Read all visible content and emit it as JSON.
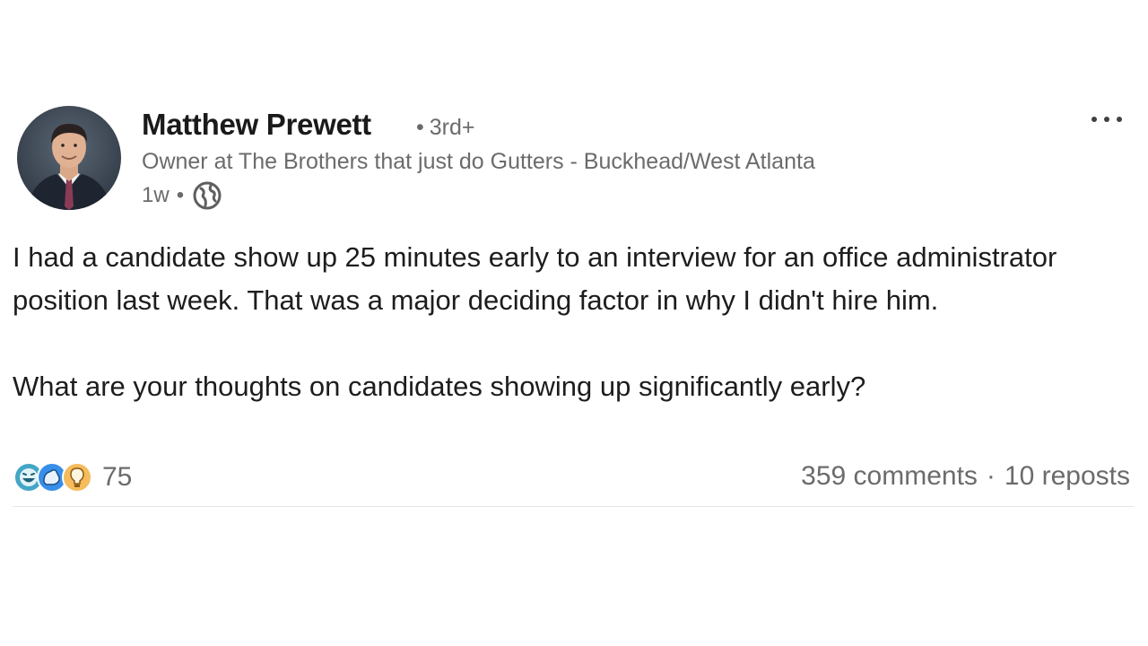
{
  "author": {
    "name": "Matthew Prewett",
    "degree": "3rd+",
    "headline": "Owner at The Brothers that just do Gutters - Buckhead/West Atlanta",
    "time": "1w",
    "visibility_icon": "globe-icon"
  },
  "post": {
    "paragraphs": [
      "I had a candidate show up 25 minutes early to an interview for an office administrator position last week. That was a major deciding factor in why I didn't hire him.",
      "What are your thoughts on candidates showing up significantly early?"
    ]
  },
  "social": {
    "reaction_icons": [
      "funny-reaction-icon",
      "support-reaction-icon",
      "insightful-reaction-icon"
    ],
    "reaction_count": "75",
    "comments": "359 comments",
    "reposts": "10 reposts"
  },
  "colors": {
    "text": "#1d1d1d",
    "muted": "#6b6b6b",
    "funny": "#44a6c6",
    "support": "#378fe9",
    "insightful": "#f5bb5c"
  }
}
